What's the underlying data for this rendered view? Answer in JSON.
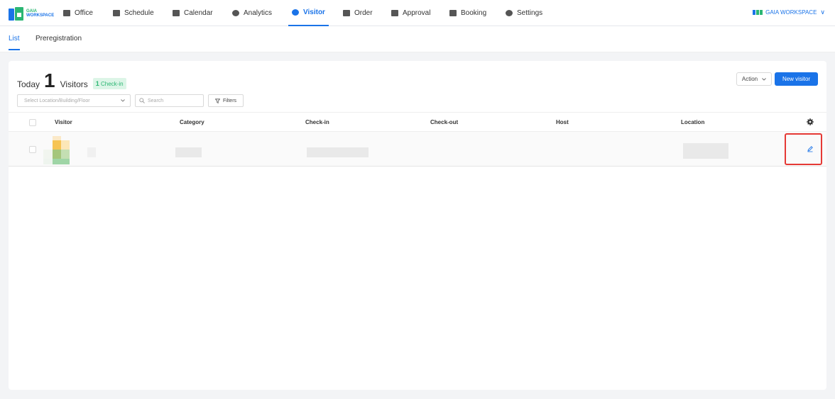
{
  "nav": {
    "logo_line1": "GAIA",
    "logo_line2": "WORKSPACE",
    "items": [
      {
        "label": "Office",
        "icon": "office-icon"
      },
      {
        "label": "Schedule",
        "icon": "schedule-icon"
      },
      {
        "label": "Calendar",
        "icon": "calendar-icon"
      },
      {
        "label": "Analytics",
        "icon": "analytics-icon"
      },
      {
        "label": "Visitor",
        "icon": "visitor-icon",
        "active": true
      },
      {
        "label": "Order",
        "icon": "order-icon"
      },
      {
        "label": "Approval",
        "icon": "approval-icon"
      },
      {
        "label": "Booking",
        "icon": "booking-icon"
      },
      {
        "label": "Settings",
        "icon": "settings-icon"
      }
    ],
    "workspace_label": "GAIA WORKSPACE",
    "workspace_chevron": "∨"
  },
  "subtabs": [
    {
      "label": "List",
      "active": true
    },
    {
      "label": "Preregistration"
    }
  ],
  "summary": {
    "today_label": "Today",
    "count": "1",
    "visitors_label": "Visitors",
    "badge_count": "1",
    "badge_label": "Check-in"
  },
  "actions": {
    "action_label": "Action",
    "new_visitor_label": "New visitor"
  },
  "filters": {
    "location_placeholder": "Select Location/Building/Floor",
    "search_placeholder": "Search",
    "filters_label": "Filters"
  },
  "table": {
    "columns": [
      "Visitor",
      "Category",
      "Check-in",
      "Check-out",
      "Host",
      "Location"
    ]
  },
  "colors": {
    "accent": "#1a73e8",
    "badge_green": "#2bb673",
    "highlight_red": "#e53935"
  }
}
